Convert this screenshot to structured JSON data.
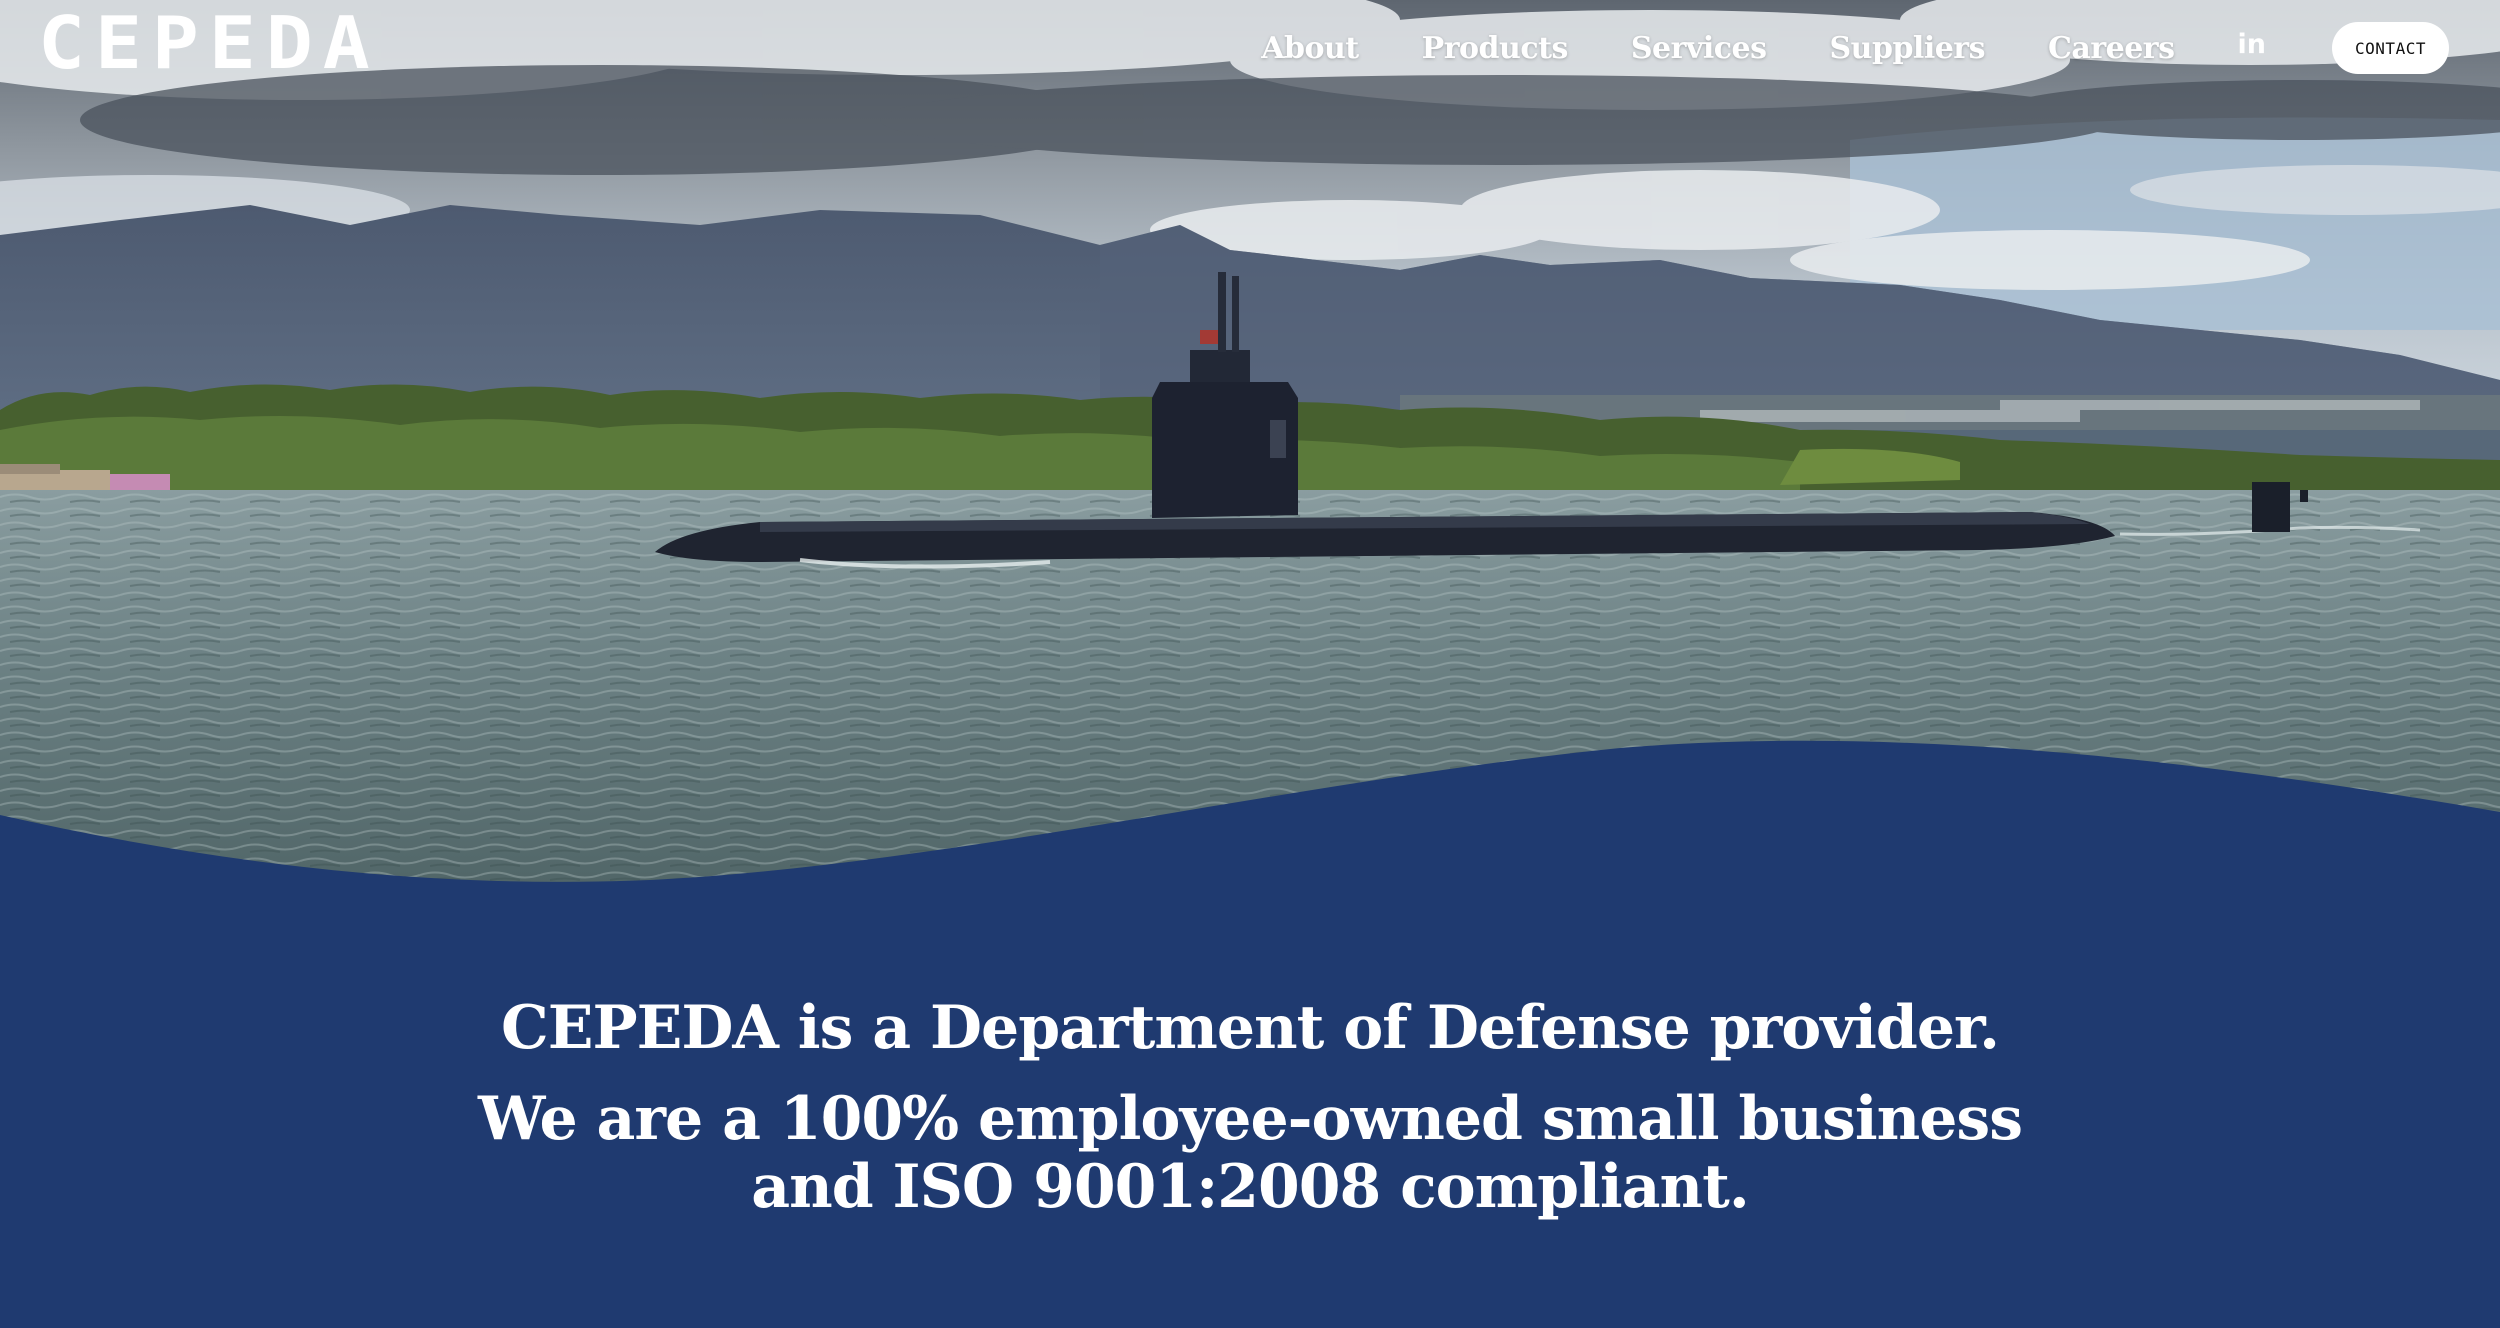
{
  "brand": {
    "logo_text": "CEPEDA"
  },
  "nav": {
    "items": [
      "About",
      "Products",
      "Services",
      "Suppliers",
      "Careers"
    ],
    "linkedin_label": "in",
    "contact_label": "CONTACT"
  },
  "hero": {
    "image_subject": "submarine-at-sea"
  },
  "mission": {
    "line1": "CEPEDA is a Department of Defense provider.",
    "line2": "We are a 100% employee-owned small business and ISO 9001:2008 compliant."
  },
  "colors": {
    "panel_blue": "#1f3a70",
    "nav_text": "#ffffff",
    "contact_bg": "#ffffff",
    "contact_text": "#111111"
  }
}
